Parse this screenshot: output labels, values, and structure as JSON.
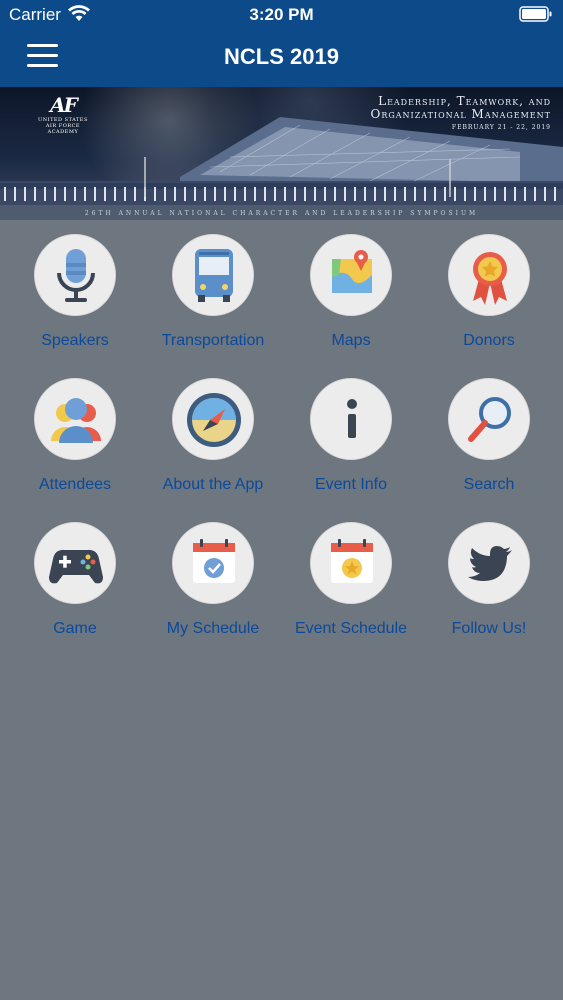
{
  "status_bar": {
    "carrier": "Carrier",
    "time": "3:20 PM"
  },
  "nav": {
    "title": "NCLS 2019",
    "menu_icon": "hamburger-menu-icon"
  },
  "banner": {
    "logo_mark": "AF",
    "logo_line1": "UNITED STATES",
    "logo_line2": "AIR FORCE",
    "logo_line3": "ACADEMY",
    "headline_1": "Leadership, Teamwork, and",
    "headline_2": "Organizational Management",
    "date": "FEBRUARY 21 - 22, 2019",
    "footer": "26TH ANNUAL NATIONAL CHARACTER AND LEADERSHIP SYMPOSIUM"
  },
  "grid": {
    "items": [
      {
        "label": "Speakers",
        "icon": "microphone-icon"
      },
      {
        "label": "Transportation",
        "icon": "bus-icon"
      },
      {
        "label": "Maps",
        "icon": "map-pin-icon"
      },
      {
        "label": "Donors",
        "icon": "award-ribbon-icon"
      },
      {
        "label": "Attendees",
        "icon": "people-icon"
      },
      {
        "label": "About the App",
        "icon": "compass-icon"
      },
      {
        "label": "Event Info",
        "icon": "info-icon"
      },
      {
        "label": "Search",
        "icon": "magnifier-icon"
      },
      {
        "label": "Game",
        "icon": "gamepad-icon"
      },
      {
        "label": "My Schedule",
        "icon": "calendar-check-icon"
      },
      {
        "label": "Event Schedule",
        "icon": "calendar-star-icon"
      },
      {
        "label": "Follow Us!",
        "icon": "twitter-bird-icon"
      }
    ]
  },
  "colors": {
    "nav_bg": "#0c4a8a",
    "page_bg": "#6e7680",
    "label": "#0b4a9a",
    "icon_circle": "#ececec"
  }
}
